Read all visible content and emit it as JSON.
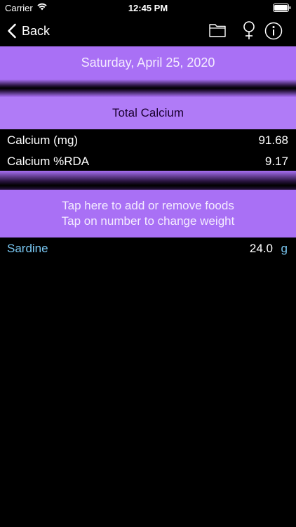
{
  "status_bar": {
    "carrier": "Carrier",
    "time": "12:45 PM"
  },
  "nav": {
    "back_label": "Back",
    "icons": [
      "folder-icon",
      "female-symbol-icon",
      "info-icon"
    ]
  },
  "date_header": "Saturday, April 25, 2020",
  "total_header": "Total Calcium",
  "nutrients": [
    {
      "label": "Calcium (mg)",
      "value": "91.68"
    },
    {
      "label": "Calcium %RDA",
      "value": "9.17"
    }
  ],
  "instructions": {
    "line1": "Tap here to add or remove foods",
    "line2": "Tap on number to change weight"
  },
  "foods": [
    {
      "name": "Sardine",
      "weight": "24.0",
      "unit": "g"
    }
  ],
  "colors": {
    "accent_purple": "#b07bf7",
    "food_blue": "#79c7f2",
    "background": "#000000"
  }
}
